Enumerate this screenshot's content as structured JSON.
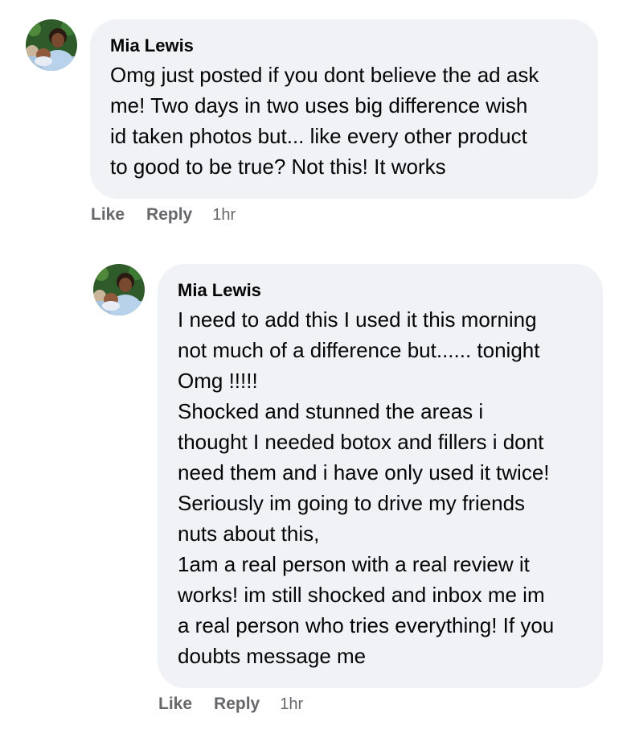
{
  "comments": [
    {
      "author": "Mia Lewis",
      "text": "Omg just posted if you dont believe the ad ask\nme! Two days in two uses big difference wish\nid taken photos but... like every other product\nto good to be true? Not this! It works",
      "like_label": "Like",
      "reply_label": "Reply",
      "time": "1hr",
      "avatar_icon": "profile-photo-woman-with-child"
    },
    {
      "author": "Mia Lewis",
      "text": "I need to add this I used it this morning\nnot much of a difference but...... tonight\nOmg !!!!!\nShocked and stunned the areas i\nthought I needed botox and fillers i dont\nneed them and i have only used it twice!\nSeriously im going to drive my friends\nnuts about this,\n1am a real person with a real review it\nworks! im still shocked and inbox me im\na real person who tries everything! If you\ndoubts message me",
      "like_label": "Like",
      "reply_label": "Reply",
      "time": "1hr",
      "avatar_icon": "profile-photo-woman-with-child"
    }
  ],
  "colors": {
    "bubble_bg": "#f0f2f5",
    "text": "#050505",
    "secondary_text": "#65676b"
  }
}
